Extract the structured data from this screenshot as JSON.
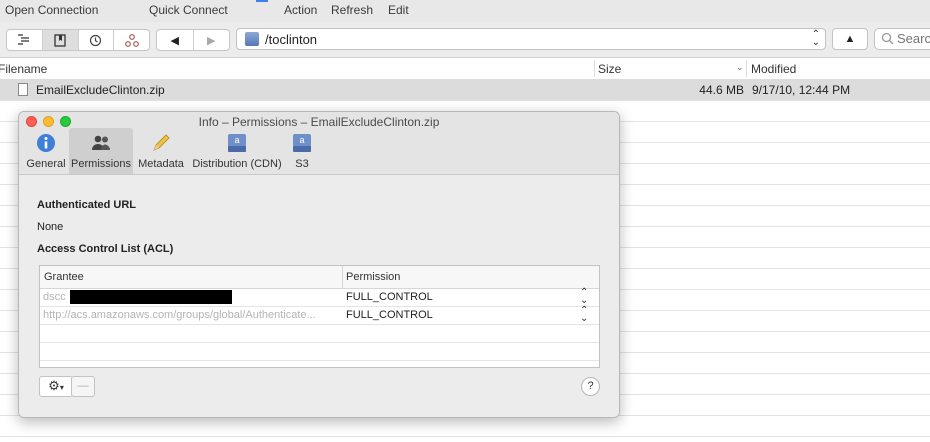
{
  "toolbar": {
    "open_connection": "Open Connection",
    "quick_connect": "Quick Connect",
    "action": "Action",
    "refresh": "Refresh",
    "edit": "Edit"
  },
  "navigation": {
    "path": "/toclinton",
    "search_placeholder": "Search",
    "back_glyph": "◀",
    "forward_glyph": "▶",
    "up_glyph": "▲"
  },
  "file_list": {
    "columns": {
      "filename": "Filename",
      "size": "Size",
      "modified": "Modified"
    },
    "rows": [
      {
        "name": "EmailExcludeClinton.zip",
        "size": "44.6 MB",
        "modified": "9/17/10, 12:44 PM",
        "selected": true
      }
    ]
  },
  "info_window": {
    "title": "Info – Permissions – EmailExcludeClinton.zip",
    "tabs": [
      {
        "label": "General",
        "icon": "info-icon",
        "selected": false
      },
      {
        "label": "Permissions",
        "icon": "users-icon",
        "selected": true
      },
      {
        "label": "Metadata",
        "icon": "pencil-icon",
        "selected": false
      },
      {
        "label": "Distribution (CDN)",
        "icon": "amazon-drive-icon",
        "selected": false
      },
      {
        "label": "S3",
        "icon": "amazon-drive-icon",
        "selected": false
      }
    ],
    "authenticated_url_heading": "Authenticated URL",
    "authenticated_url_value": "None",
    "acl_heading": "Access Control List (ACL)",
    "acl_columns": {
      "grantee": "Grantee",
      "permission": "Permission"
    },
    "acl_rows": [
      {
        "grantee": "dscc",
        "permission": "FULL_CONTROL",
        "redacted": true
      },
      {
        "grantee": "http://acs.amazonaws.com/groups/global/Authenticate...",
        "permission": "FULL_CONTROL",
        "redacted": false
      }
    ],
    "remove_button": "—",
    "help_button": "?"
  }
}
